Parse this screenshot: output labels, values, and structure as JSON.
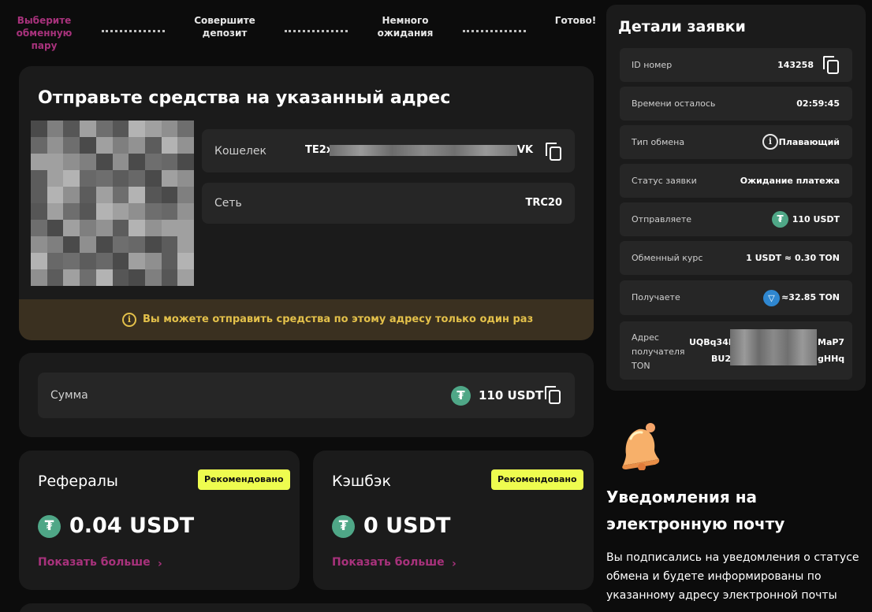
{
  "stepper": {
    "steps": [
      {
        "label": "Выберите обменную пару"
      },
      {
        "label": "Совершите депозит"
      },
      {
        "label": "Немного ожидания"
      },
      {
        "label": "Готово!"
      }
    ]
  },
  "send": {
    "title": "Отправьте средства на указанный адрес",
    "wallet_label": "Кошелек",
    "wallet_prefix": "TE2x",
    "wallet_suffix": "VK",
    "network_label": "Сеть",
    "network_value": "TRC20",
    "warning": "Вы можете отправить средства по этому адресу только один раз"
  },
  "sum": {
    "label": "Сумма",
    "value": "110 USDT"
  },
  "referrals": {
    "title": "Рефералы",
    "badge": "Рекомендовано",
    "amount": "0.04 USDT",
    "link": "Показать больше"
  },
  "cashback": {
    "title": "Кэшбэк",
    "badge": "Рекомендовано",
    "amount": "0 USDT",
    "link": "Показать больше"
  },
  "details": {
    "title": "Детали заявки",
    "rows": [
      {
        "label": "ID номер",
        "value": "143258"
      },
      {
        "label": "Времени осталось",
        "value": "02:59:45"
      },
      {
        "label": "Тип обмена",
        "value": "Плавающий"
      },
      {
        "label": "Статус заявки",
        "value": "Ожидание платежа"
      },
      {
        "label": "Отправляете",
        "value": "110 USDT"
      },
      {
        "label": "Обменный курс",
        "value": "1 USDT ≈ 0.30 TON"
      },
      {
        "label": "Получаете",
        "value": "≈32.85 TON"
      }
    ],
    "address": {
      "label": "Адрес получателя TON",
      "line1_prefix": "UQBq34R",
      "line1_suffix": "MaP7",
      "line2_prefix": "BU2",
      "line2_suffix": "gHHq"
    }
  },
  "notifications": {
    "title": "Уведомления на электронную почту",
    "text": "Вы подписались на уведомления о статусе обмена и будете информированы по указанному адресу электронной почты"
  },
  "colors": {
    "accent": "#a8327c",
    "badge": "#eefc4f",
    "tether": "#4fa787",
    "ton": "#2f87d0",
    "warning": "#e3c04a"
  },
  "icons": [
    "copy-icon",
    "info-icon",
    "tether-icon",
    "ton-icon",
    "bell-icon",
    "chevron-right-icon"
  ]
}
